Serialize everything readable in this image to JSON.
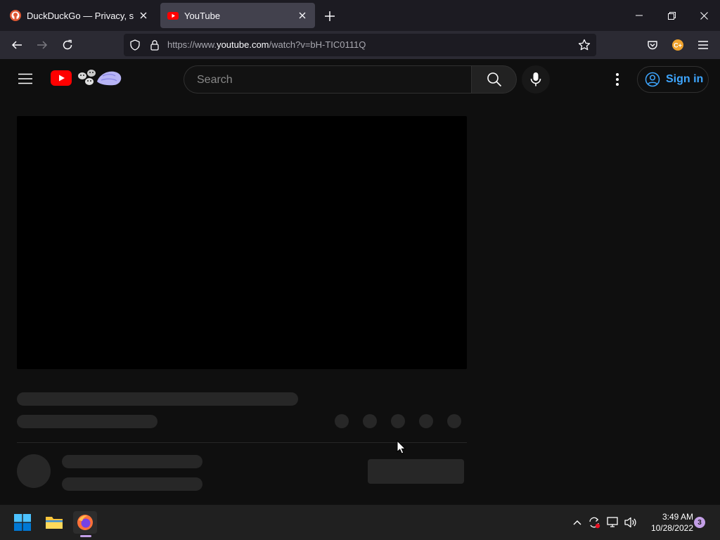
{
  "browser": {
    "tabs": [
      {
        "title": "DuckDuckGo — Privacy, simplified.",
        "active": false
      },
      {
        "title": "YouTube",
        "active": true
      }
    ],
    "url": {
      "prefix": "https://www.",
      "host": "youtube.com",
      "path": "/watch?v=bH-TIC0111Q"
    }
  },
  "youtube": {
    "search_placeholder": "Search",
    "sign_in_label": "Sign in"
  },
  "taskbar": {
    "time": "3:49 AM",
    "date": "10/28/2022",
    "notification_count": "3"
  },
  "colors": {
    "yt_red": "#ff0000",
    "signin_blue": "#3ea6ff",
    "page_bg": "#0f0f0f",
    "skeleton": "#272727",
    "firefox_accent": "#c39fe6"
  },
  "icons": [
    "duckduckgo-favicon",
    "youtube-favicon",
    "close-icon",
    "plus-icon",
    "minimize-icon",
    "restore-icon",
    "back-arrow-icon",
    "forward-arrow-icon",
    "reload-icon",
    "shield-icon",
    "lock-icon",
    "star-icon",
    "pocket-icon",
    "extension-icon",
    "hamburger-menu-icon",
    "youtube-logo",
    "search-icon",
    "microphone-icon",
    "more-vertical-icon",
    "account-icon",
    "windows-start-icon",
    "file-explorer-icon",
    "firefox-icon",
    "chevron-up-icon",
    "sync-icon",
    "network-icon",
    "volume-icon",
    "mouse-cursor-icon"
  ]
}
